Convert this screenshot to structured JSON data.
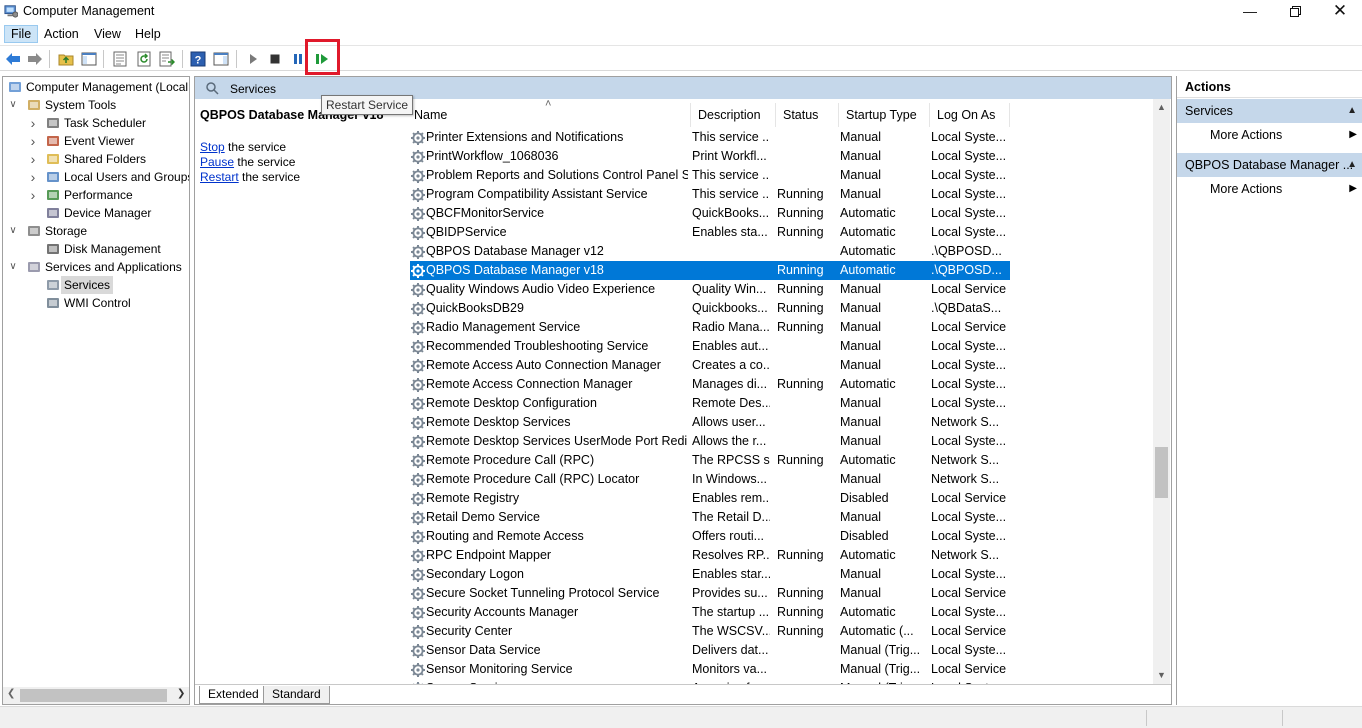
{
  "window": {
    "title": "Computer Management"
  },
  "menu": [
    "File",
    "Action",
    "View",
    "Help"
  ],
  "toolbar": {
    "tooltip": "Restart Service"
  },
  "tree": [
    {
      "label": "Computer Management (Local",
      "icon": "computer-management-icon",
      "chev": "",
      "indent": 0
    },
    {
      "label": "System Tools",
      "icon": "system-tools-icon",
      "chev": "v",
      "indent": 1
    },
    {
      "label": "Task Scheduler",
      "icon": "task-scheduler-icon",
      "chev": ">",
      "indent": 2
    },
    {
      "label": "Event Viewer",
      "icon": "event-viewer-icon",
      "chev": ">",
      "indent": 2
    },
    {
      "label": "Shared Folders",
      "icon": "shared-folders-icon",
      "chev": ">",
      "indent": 2
    },
    {
      "label": "Local Users and Groups",
      "icon": "local-users-icon",
      "chev": ">",
      "indent": 2
    },
    {
      "label": "Performance",
      "icon": "performance-icon",
      "chev": ">",
      "indent": 2
    },
    {
      "label": "Device Manager",
      "icon": "device-manager-icon",
      "chev": "",
      "indent": 2
    },
    {
      "label": "Storage",
      "icon": "storage-icon",
      "chev": "v",
      "indent": 1
    },
    {
      "label": "Disk Management",
      "icon": "disk-management-icon",
      "chev": "",
      "indent": 2
    },
    {
      "label": "Services and Applications",
      "icon": "services-applications-icon",
      "chev": "v",
      "indent": 1
    },
    {
      "label": "Services",
      "icon": "services-icon",
      "chev": "",
      "indent": 2,
      "selected": true
    },
    {
      "label": "WMI Control",
      "icon": "wmi-control-icon",
      "chev": "",
      "indent": 2
    }
  ],
  "center": {
    "header": "Services",
    "selected_service": "QBPOS Database Manager v18",
    "actions": [
      {
        "link": "Stop",
        "rest": " the service"
      },
      {
        "link": "Pause",
        "rest": " the service"
      },
      {
        "link": "Restart",
        "rest": " the service"
      }
    ]
  },
  "columns": [
    "Name",
    "Description",
    "Status",
    "Startup Type",
    "Log On As"
  ],
  "rows": [
    [
      "Printer Extensions and Notifications",
      "This service ...",
      "",
      "Manual",
      "Local Syste..."
    ],
    [
      "PrintWorkflow_1068036",
      "Print Workfl...",
      "",
      "Manual",
      "Local Syste..."
    ],
    [
      "Problem Reports and Solutions Control Panel S...",
      "This service ...",
      "",
      "Manual",
      "Local Syste..."
    ],
    [
      "Program Compatibility Assistant Service",
      "This service ...",
      "Running",
      "Manual",
      "Local Syste..."
    ],
    [
      "QBCFMonitorService",
      "QuickBooks...",
      "Running",
      "Automatic",
      "Local Syste..."
    ],
    [
      "QBIDPService",
      "Enables sta...",
      "Running",
      "Automatic",
      "Local Syste..."
    ],
    [
      "QBPOS Database Manager v12",
      "",
      "",
      "Automatic",
      ".\\QBPOSD..."
    ],
    [
      "QBPOS Database Manager v18",
      "",
      "Running",
      "Automatic",
      ".\\QBPOSD..."
    ],
    [
      "Quality Windows Audio Video Experience",
      "Quality Win...",
      "Running",
      "Manual",
      "Local Service"
    ],
    [
      "QuickBooksDB29",
      "Quickbooks...",
      "Running",
      "Manual",
      ".\\QBDataS..."
    ],
    [
      "Radio Management Service",
      "Radio Mana...",
      "Running",
      "Manual",
      "Local Service"
    ],
    [
      "Recommended Troubleshooting Service",
      "Enables aut...",
      "",
      "Manual",
      "Local Syste..."
    ],
    [
      "Remote Access Auto Connection Manager",
      "Creates a co...",
      "",
      "Manual",
      "Local Syste..."
    ],
    [
      "Remote Access Connection Manager",
      "Manages di...",
      "Running",
      "Automatic",
      "Local Syste..."
    ],
    [
      "Remote Desktop Configuration",
      "Remote Des...",
      "",
      "Manual",
      "Local Syste..."
    ],
    [
      "Remote Desktop Services",
      "Allows user...",
      "",
      "Manual",
      "Network S..."
    ],
    [
      "Remote Desktop Services UserMode Port Redire...",
      "Allows the r...",
      "",
      "Manual",
      "Local Syste..."
    ],
    [
      "Remote Procedure Call (RPC)",
      "The RPCSS s...",
      "Running",
      "Automatic",
      "Network S..."
    ],
    [
      "Remote Procedure Call (RPC) Locator",
      "In Windows...",
      "",
      "Manual",
      "Network S..."
    ],
    [
      "Remote Registry",
      "Enables rem...",
      "",
      "Disabled",
      "Local Service"
    ],
    [
      "Retail Demo Service",
      "The Retail D...",
      "",
      "Manual",
      "Local Syste..."
    ],
    [
      "Routing and Remote Access",
      "Offers routi...",
      "",
      "Disabled",
      "Local Syste..."
    ],
    [
      "RPC Endpoint Mapper",
      "Resolves RP...",
      "Running",
      "Automatic",
      "Network S..."
    ],
    [
      "Secondary Logon",
      "Enables star...",
      "",
      "Manual",
      "Local Syste..."
    ],
    [
      "Secure Socket Tunneling Protocol Service",
      "Provides su...",
      "Running",
      "Manual",
      "Local Service"
    ],
    [
      "Security Accounts Manager",
      "The startup ...",
      "Running",
      "Automatic",
      "Local Syste..."
    ],
    [
      "Security Center",
      "The WSCSV...",
      "Running",
      "Automatic (...",
      "Local Service"
    ],
    [
      "Sensor Data Service",
      "Delivers dat...",
      "",
      "Manual (Trig...",
      "Local Syste..."
    ],
    [
      "Sensor Monitoring Service",
      "Monitors va...",
      "",
      "Manual (Trig...",
      "Local Service"
    ],
    [
      "Sensor Service",
      "A service fo...",
      "",
      "Manual (Trig...",
      "Local Syste..."
    ]
  ],
  "selected_row": 7,
  "tabs": [
    "Extended",
    "Standard"
  ],
  "actions_pane": {
    "title": "Actions",
    "sections": [
      {
        "label": "Services",
        "item": "More Actions"
      },
      {
        "label": "QBPOS Database Manager ...",
        "item": "More Actions"
      }
    ]
  },
  "colors": {
    "accent": "#0078d7",
    "header_bg": "#c5d7ea",
    "highlight_box": "#e0192b"
  }
}
